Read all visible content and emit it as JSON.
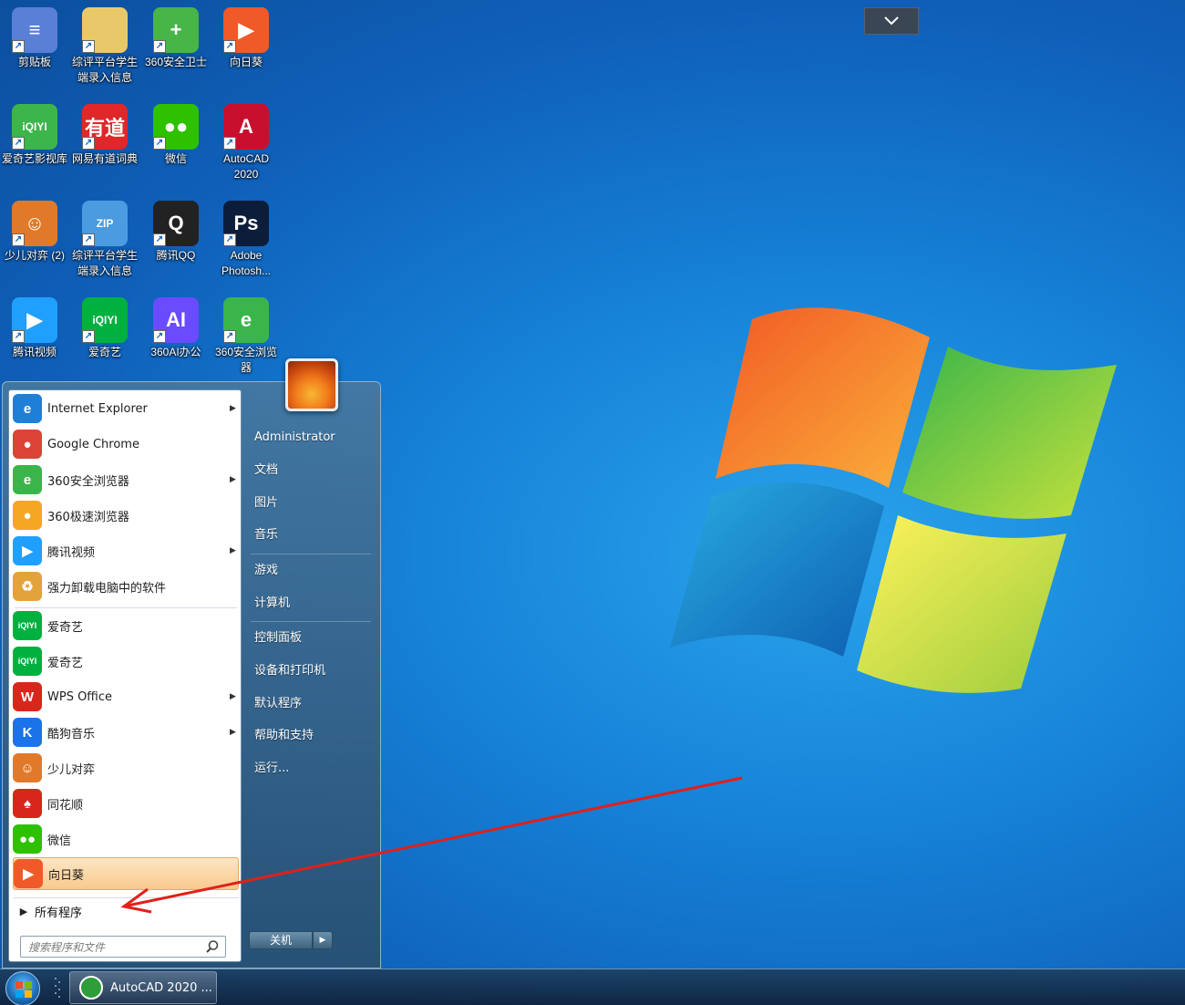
{
  "desktop_icons": [
    {
      "label": "剪贴板",
      "icon": "clipboard-icon",
      "color": "#5a7fd6",
      "glyph": "≡"
    },
    {
      "label": "综评平台学生端录入信息",
      "icon": "folder-icon",
      "color": "#e9c86a",
      "glyph": ""
    },
    {
      "label": "360安全卫士",
      "icon": "360-safe-icon",
      "color": "#48b548",
      "glyph": "+"
    },
    {
      "label": "向日葵",
      "icon": "sunlogin-icon",
      "color": "#f05a28",
      "glyph": "▶"
    },
    {
      "label": "爱奇艺影视库",
      "icon": "iqiyi-folder-icon",
      "color": "#3cb54a",
      "glyph": "iQIYI"
    },
    {
      "label": "网易有道词典",
      "icon": "youdao-icon",
      "color": "#e0272a",
      "glyph": "有道"
    },
    {
      "label": "微信",
      "icon": "wechat-icon",
      "color": "#2dc100",
      "glyph": "●●"
    },
    {
      "label": "AutoCAD 2020",
      "icon": "autocad-icon",
      "color": "#c8102e",
      "glyph": "A"
    },
    {
      "label": "少儿对弈 (2)",
      "icon": "chess-kid-icon",
      "color": "#e07a2a",
      "glyph": "☺"
    },
    {
      "label": "综评平台学生端录入信息",
      "icon": "zip-icon",
      "color": "#4a9be0",
      "glyph": "ZIP"
    },
    {
      "label": "腾讯QQ",
      "icon": "qq-icon",
      "color": "#222222",
      "glyph": "Q"
    },
    {
      "label": "Adobe Photosh...",
      "icon": "photoshop-icon",
      "color": "#0b1d3b",
      "glyph": "Ps"
    },
    {
      "label": "腾讯视频",
      "icon": "tencent-video-icon",
      "color": "#1fa0ff",
      "glyph": "▶"
    },
    {
      "label": "爱奇艺",
      "icon": "iqiyi-icon",
      "color": "#00b140",
      "glyph": "iQIYI"
    },
    {
      "label": "360AI办公",
      "icon": "360-ai-icon",
      "color": "#6a4bff",
      "glyph": "AI"
    },
    {
      "label": "360安全浏览器",
      "icon": "360-browser-icon",
      "color": "#3ab54a",
      "glyph": "e"
    }
  ],
  "start_menu": {
    "programs": [
      {
        "label": "Internet Explorer",
        "icon": "ie-icon",
        "color": "#1e7fd8",
        "glyph": "e",
        "submenu": "▶"
      },
      {
        "label": "Google Chrome",
        "icon": "chrome-icon",
        "color": "#db4437",
        "glyph": "●",
        "submenu": ""
      },
      {
        "label": "360安全浏览器",
        "icon": "360-browser-icon",
        "color": "#3ab54a",
        "glyph": "e",
        "submenu": "▶"
      },
      {
        "label": "360极速浏览器",
        "icon": "360-speed-browser-icon",
        "color": "#f5a623",
        "glyph": "●",
        "submenu": ""
      },
      {
        "label": "腾讯视频",
        "icon": "tencent-video-icon",
        "color": "#1fa0ff",
        "glyph": "▶",
        "submenu": "▶"
      },
      {
        "label": "强力卸载电脑中的软件",
        "icon": "uninstall-icon",
        "color": "#e3a33a",
        "glyph": "♻",
        "submenu": ""
      },
      {
        "label": "爱奇艺",
        "icon": "iqiyi-icon",
        "color": "#00b140",
        "glyph": "iQIYI",
        "submenu": ""
      },
      {
        "label": "爱奇艺",
        "icon": "iqiyi-icon",
        "color": "#00b140",
        "glyph": "iQIYI",
        "submenu": ""
      },
      {
        "label": "WPS Office",
        "icon": "wps-icon",
        "color": "#d9261c",
        "glyph": "W",
        "submenu": "▶"
      },
      {
        "label": "酷狗音乐",
        "icon": "kugou-icon",
        "color": "#1a73e8",
        "glyph": "K",
        "submenu": "▶"
      },
      {
        "label": "少儿对弈",
        "icon": "chess-kid-icon",
        "color": "#e07a2a",
        "glyph": "☺",
        "submenu": ""
      },
      {
        "label": "同花顺",
        "icon": "tonghuashun-icon",
        "color": "#d9261c",
        "glyph": "♠",
        "submenu": ""
      },
      {
        "label": "微信",
        "icon": "wechat-icon",
        "color": "#2dc100",
        "glyph": "●●",
        "submenu": ""
      },
      {
        "label": "向日葵",
        "icon": "sunlogin-icon",
        "color": "#f05a28",
        "glyph": "▶",
        "submenu": ""
      }
    ],
    "all_programs": "所有程序",
    "search_placeholder": "搜索程序和文件",
    "right_items": [
      "Administrator",
      "文档",
      "图片",
      "音乐",
      "游戏",
      "计算机",
      "控制面板",
      "设备和打印机",
      "默认程序",
      "帮助和支持",
      "运行..."
    ],
    "shutdown_label": "关机",
    "shutdown_arrow": "▶"
  },
  "taskbar": {
    "active_window": "AutoCAD 2020 ..."
  },
  "colors": {
    "annotation": "#e0201a",
    "highlight": "#f9c98d"
  }
}
